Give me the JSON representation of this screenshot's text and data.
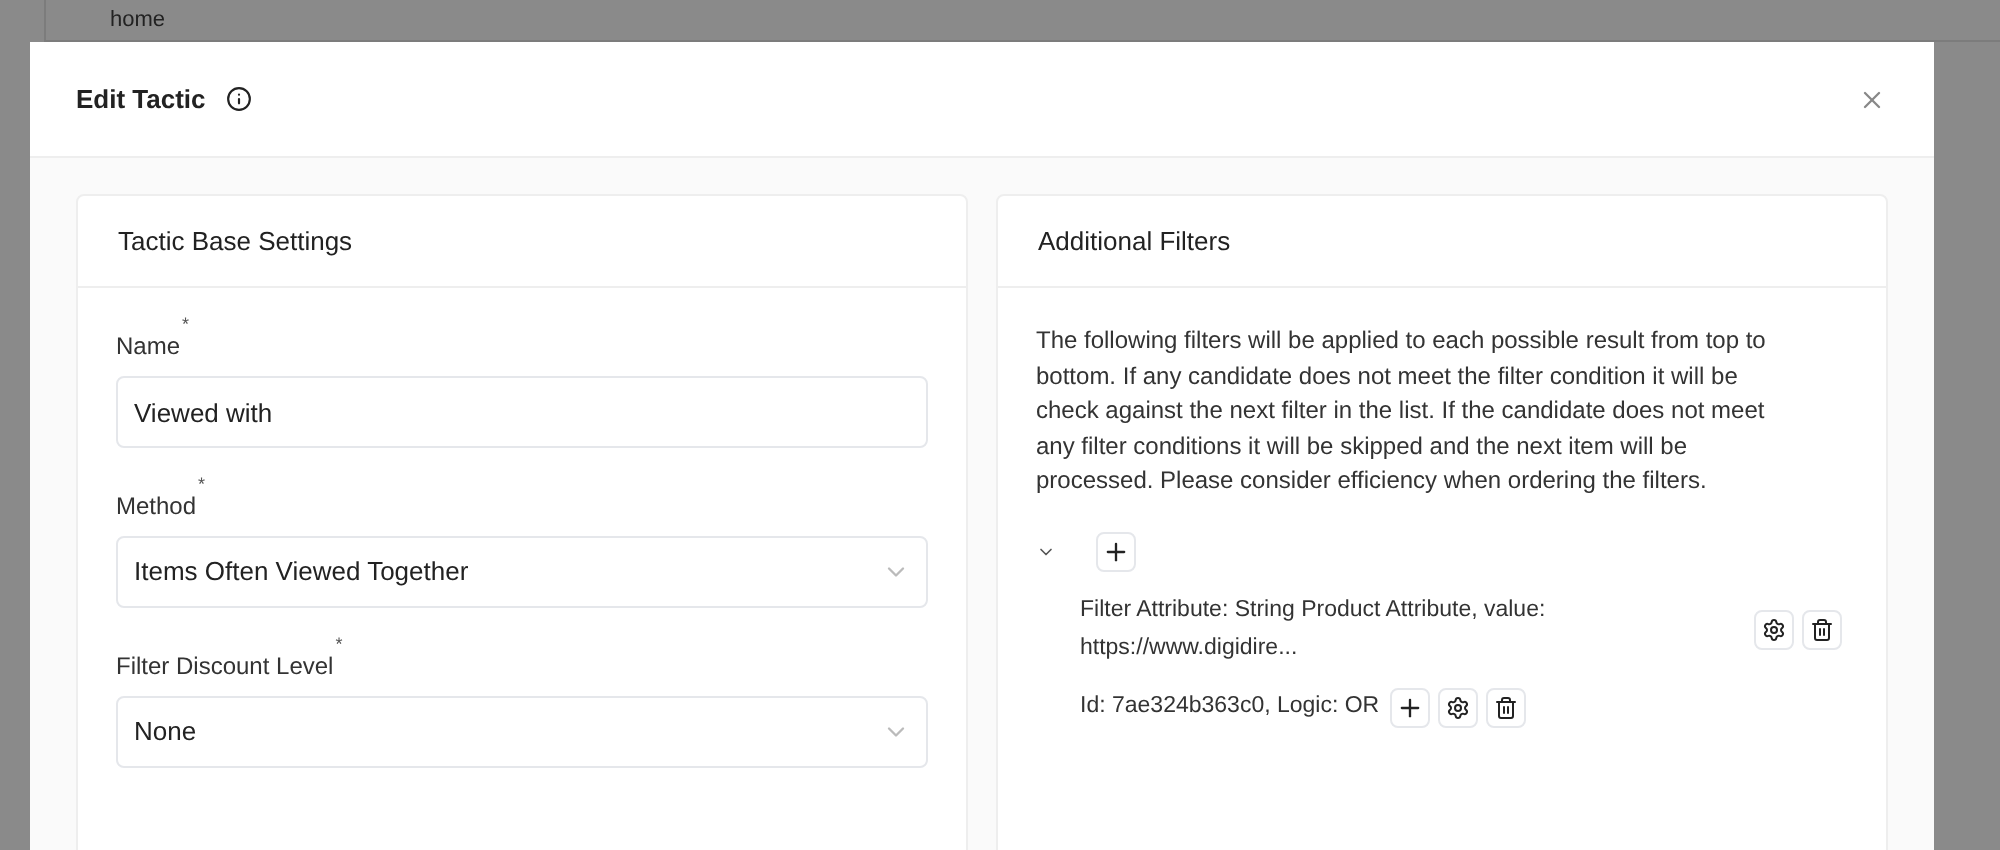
{
  "background": {
    "breadcrumb": "home"
  },
  "dialog": {
    "title": "Edit Tactic"
  },
  "base_settings": {
    "title": "Tactic Base Settings",
    "fields": [
      {
        "kind": "text",
        "label": "Name",
        "required_mark": "*",
        "value": "Viewed with"
      },
      {
        "kind": "select",
        "label": "Method",
        "required_mark": "*",
        "value": "Items Often Viewed Together"
      },
      {
        "kind": "select",
        "label": "Filter Discount Level",
        "required_mark": "*",
        "value": "None"
      }
    ]
  },
  "filters": {
    "title": "Additional Filters",
    "description": "The following filters will be applied to each possible result from top to bottom. If any candidate does not meet the filter condition it will be check against the next filter in the list. If the candidate does not meet any filter conditions it will be skipped and the next item will be processed. Please consider efficiency when ordering the filters.",
    "group": {
      "expanded": true,
      "filter": "Filter Attribute: String Product Attribute, value: https://www.digidire...",
      "footer": "Id: 7ae324b363c0, Logic: OR"
    }
  }
}
